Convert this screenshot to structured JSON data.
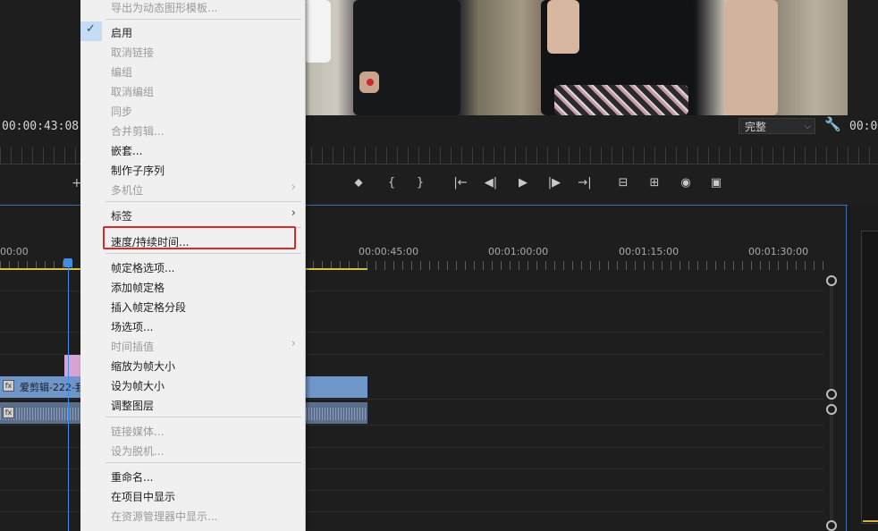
{
  "monitor": {
    "timecode_left": "00:00:43:08",
    "timecode_right": "00:0",
    "resolution_value": "完整",
    "resolution_icon": "chevron-down-icon",
    "settings_icon": "wrench-icon"
  },
  "transport": {
    "marker": "⬥",
    "in": "{",
    "out": "}",
    "go_in": "|←",
    "step_back": "◀|",
    "play": "▶",
    "step_forward": "|▶",
    "go_out": "→|",
    "lift": "⊟",
    "extract": "⊞",
    "export_frame": "◉",
    "compare": "▣",
    "add": "+"
  },
  "timeline": {
    "ruler_labels": [
      "00:00",
      "00:00:45:00",
      "00:01:00:00",
      "00:01:15:00",
      "00:01:30:00"
    ],
    "video_clip_label": "爱剪辑-222-我",
    "fx_badge": "fx",
    "playhead_color": "#3d8ee8",
    "clip_color": "#6f95c9"
  },
  "context_menu": {
    "items": [
      {
        "label": "导出为动态图形模板...",
        "enabled": false
      },
      {
        "label": "启用",
        "enabled": true,
        "checked": true
      },
      {
        "label": "取消链接",
        "enabled": false
      },
      {
        "label": "编组",
        "enabled": false
      },
      {
        "label": "取消编组",
        "enabled": false
      },
      {
        "label": "同步",
        "enabled": false
      },
      {
        "label": "合并剪辑...",
        "enabled": false
      },
      {
        "label": "嵌套...",
        "enabled": true
      },
      {
        "label": "制作子序列",
        "enabled": true
      },
      {
        "label": "多机位",
        "enabled": false,
        "submenu": true
      },
      {
        "label": "标签",
        "enabled": true,
        "submenu": true
      },
      {
        "label": "速度/持续时间...",
        "enabled": true,
        "highlighted": true
      },
      {
        "label": "帧定格选项...",
        "enabled": true
      },
      {
        "label": "添加帧定格",
        "enabled": true
      },
      {
        "label": "插入帧定格分段",
        "enabled": true
      },
      {
        "label": "场选项...",
        "enabled": true
      },
      {
        "label": "时间插值",
        "enabled": false,
        "submenu": true
      },
      {
        "label": "缩放为帧大小",
        "enabled": true
      },
      {
        "label": "设为帧大小",
        "enabled": true
      },
      {
        "label": "调整图层",
        "enabled": true
      },
      {
        "label": "链接媒体...",
        "enabled": false
      },
      {
        "label": "设为脱机...",
        "enabled": false
      },
      {
        "label": "重命名...",
        "enabled": true
      },
      {
        "label": "在项目中显示",
        "enabled": true
      },
      {
        "label": "在资源管理器中显示...",
        "enabled": false
      }
    ],
    "checkmark": "✓",
    "submenu_arrow": "›",
    "highlight_color": "#d52b2b"
  }
}
